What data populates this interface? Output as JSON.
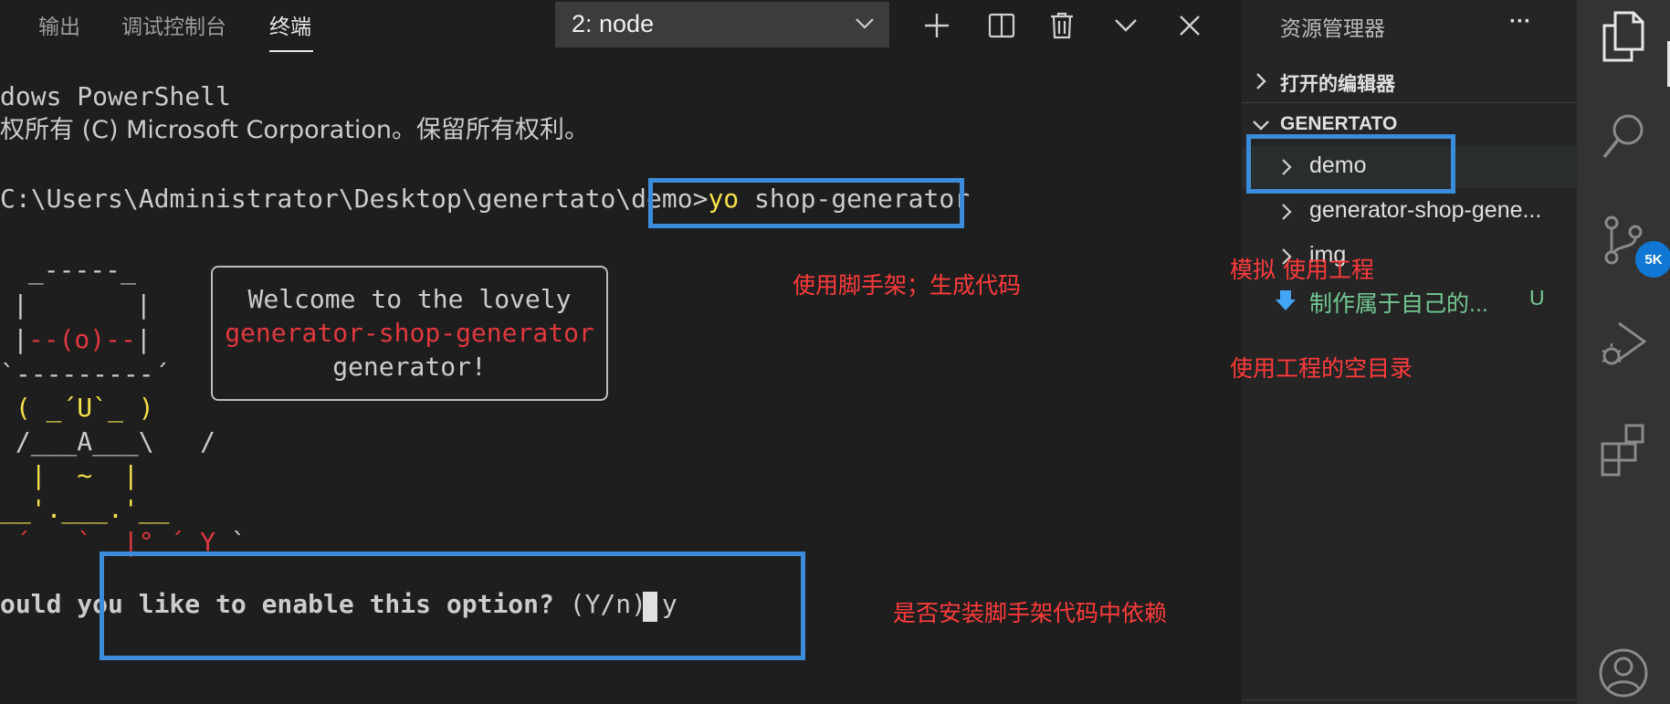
{
  "panel": {
    "tabs": [
      "输出",
      "调试控制台",
      "终端"
    ],
    "terminal_select": "2: node",
    "toolbar_icons": [
      "plus-icon",
      "split-icon",
      "trash-icon",
      "chevron-down-icon",
      "close-icon"
    ]
  },
  "terminal": {
    "lines": {
      "l1": "dows PowerShell",
      "l2": "权所有 (C) Microsoft Corporation。保留所有权利。",
      "prompt": "C:\\Users\\Administrator\\Desktop\\genertato\\demo>",
      "cmd_yo": "yo",
      "cmd_rest": " shop-generator",
      "question": "ould you like to enable this option?",
      "question_opts": " (Y/n) ",
      "answer": "y"
    },
    "welcome": {
      "line1": "Welcome to the lovely",
      "line2": "generator-shop-generator",
      "line3": "generator!"
    },
    "ascii": {
      "a1": " _-----_",
      "a2": "|       |",
      "a3": "|",
      "a3r": "--(o)--",
      "a3e": "|",
      "a4": "`---------´",
      "a5": " ( _´U`_ )",
      "a6": " /___A___\\   /",
      "a7": "  |  ~  |",
      "a8": "__'.___.'__",
      "a9a": " ´   `  ",
      "a9b": "|°",
      "a9c": " ´ Y ",
      "a9d": "`"
    }
  },
  "annotations": {
    "scaffold": "使用脚手架；生成代码",
    "simulate": "模拟 使用工程",
    "empty_dir": "使用工程的空目录",
    "deps": "是否安装脚手架代码中依赖"
  },
  "explorer": {
    "title": "资源管理器",
    "more": "···",
    "open_editors": "打开的编辑器",
    "project": "GENERTATO",
    "items": {
      "demo": "demo",
      "gen": "generator-shop-gene...",
      "img": "img",
      "md": "制作属于自己的...",
      "md_status": "U"
    }
  },
  "activity": {
    "icons": [
      "files-icon",
      "search-icon",
      "source-control-icon",
      "run-debug-icon",
      "extensions-icon",
      "account-icon"
    ],
    "scm_badge": "5K"
  },
  "colors": {
    "highlight": "#3b8ddb",
    "annotation": "#ff3b3b",
    "untracked": "#73c991"
  }
}
